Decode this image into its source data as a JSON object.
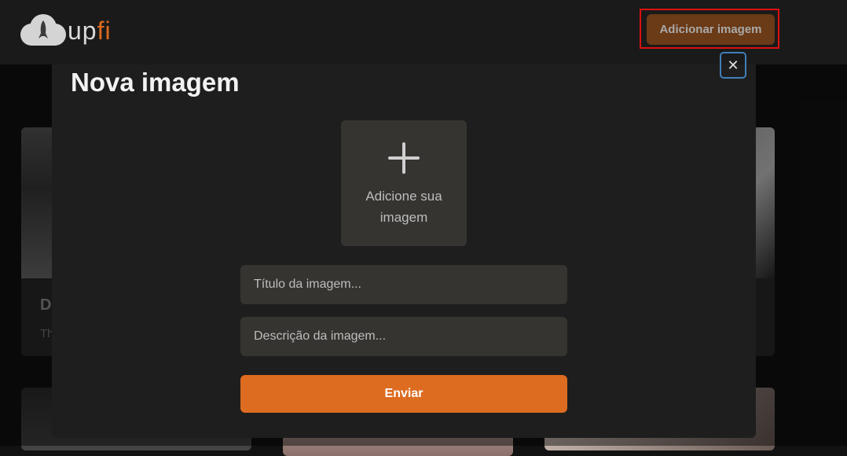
{
  "header": {
    "logo_text_main": "up",
    "logo_text_accent": "fi",
    "add_button_label": "Adicionar imagem"
  },
  "background_cards": [
    {
      "title": "D",
      "description": "Th"
    }
  ],
  "modal": {
    "title": "Nova imagem",
    "close_label": "✕",
    "upload_label": "Adicione sua imagem",
    "title_placeholder": "Título da imagem...",
    "description_placeholder": "Descrição da imagem...",
    "submit_label": "Enviar"
  },
  "colors": {
    "accent": "#dd6b20",
    "modal_bg": "#1f1e1e",
    "field_bg": "#353431"
  }
}
